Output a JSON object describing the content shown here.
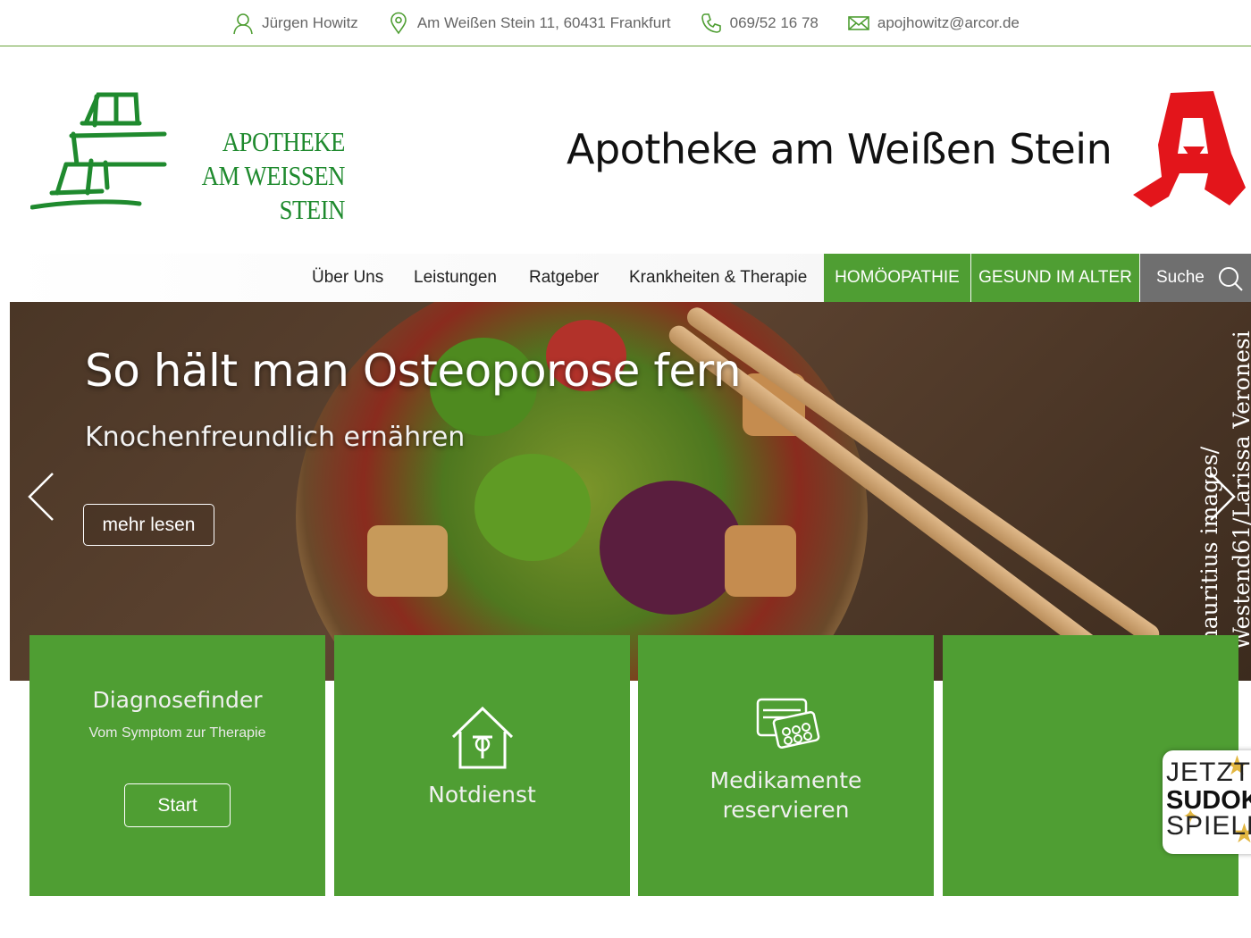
{
  "topbar": {
    "name": "Jürgen Howitz",
    "address": "Am Weißen Stein 11, 60431 Frankfurt",
    "phone": "069/52 16 78",
    "email": "apojhowitz@arcor.de"
  },
  "header": {
    "logo_line1": "APOTHEKE",
    "logo_line2": "AM WEISSEN STEIN",
    "site_title": "Apotheke am Weißen Stein"
  },
  "nav": {
    "items": [
      "Über Uns",
      "Leistungen",
      "Ratgeber",
      "Krankheiten & Therapie"
    ],
    "highlight": [
      "HOMÖOPATHIE",
      "GESUND IM ALTER"
    ],
    "search_label": "Suche"
  },
  "hero": {
    "title": "So hält man Osteoporose fern",
    "subtitle": "Knochenfreundlich ernähren",
    "button": "mehr lesen",
    "credit_line1": "mauritius images/",
    "credit_line2": "Westend61/Larissa Veronesi"
  },
  "tiles": {
    "diagnose_title": "Diagnosefinder",
    "diagnose_sub": "Vom Symptom zur Therapie",
    "diagnose_button": "Start",
    "notdienst": "Notdienst",
    "medikamente_line1": "Medikamente",
    "medikamente_line2": "reservieren"
  },
  "sudoku": {
    "line1": "JETZT",
    "line2": "SUDOKU",
    "line3": "SPIELEN"
  },
  "colors": {
    "green": "#4f9e33",
    "logo_green": "#1f8a2e",
    "apo_red": "#e3151b",
    "search_grey": "#6f6f6f"
  }
}
